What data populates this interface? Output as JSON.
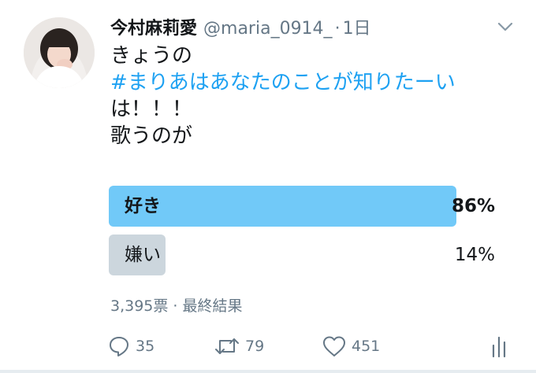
{
  "tweet": {
    "author_name": "今村麻莉愛",
    "handle": "@maria_0914_",
    "separator": "·",
    "time": "1日",
    "text_lines": [
      {
        "text": "きょうの",
        "hashtag": false
      },
      {
        "text": "#まりあはあなたのことが知りたーい",
        "hashtag": true
      },
      {
        "text": "は！！！",
        "hashtag": false
      },
      {
        "text": "歌うのが",
        "hashtag": false
      }
    ]
  },
  "poll": {
    "options": [
      {
        "label": "好き",
        "percent_text": "86%",
        "fraction": 0.86,
        "winner": true,
        "bar_color": "#71c9f8"
      },
      {
        "label": "嫌い",
        "percent_text": "14%",
        "fraction": 0.14,
        "winner": false,
        "bar_color": "#ccd6dd"
      }
    ],
    "meta": "3,395票 · 最終結果"
  },
  "actions": {
    "reply_count": "35",
    "retweet_count": "79",
    "like_count": "451",
    "reply_icon": "reply-icon",
    "retweet_icon": "retweet-icon",
    "like_icon": "heart-icon",
    "analytics_icon": "analytics-icon"
  },
  "colors": {
    "accent": "#1da1f2",
    "muted": "#657786"
  }
}
